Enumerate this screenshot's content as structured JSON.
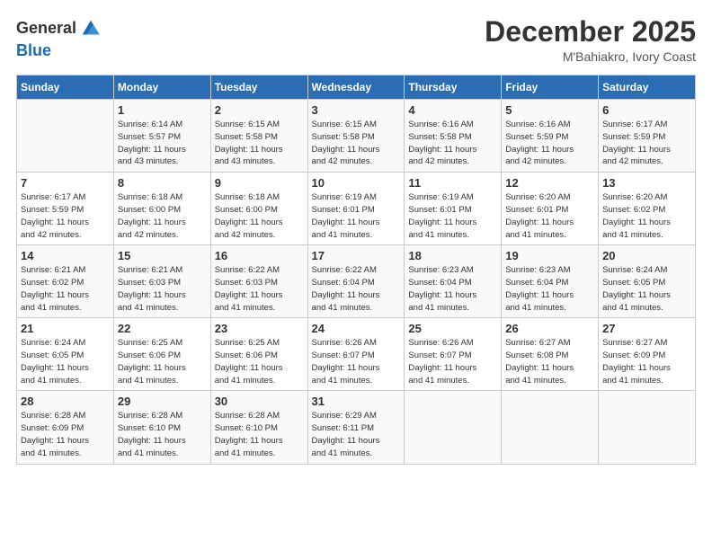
{
  "logo": {
    "general": "General",
    "blue": "Blue"
  },
  "title": "December 2025",
  "location": "M'Bahiakro, Ivory Coast",
  "days_of_week": [
    "Sunday",
    "Monday",
    "Tuesday",
    "Wednesday",
    "Thursday",
    "Friday",
    "Saturday"
  ],
  "weeks": [
    [
      {
        "day": "",
        "info": ""
      },
      {
        "day": "1",
        "info": "Sunrise: 6:14 AM\nSunset: 5:57 PM\nDaylight: 11 hours\nand 43 minutes."
      },
      {
        "day": "2",
        "info": "Sunrise: 6:15 AM\nSunset: 5:58 PM\nDaylight: 11 hours\nand 43 minutes."
      },
      {
        "day": "3",
        "info": "Sunrise: 6:15 AM\nSunset: 5:58 PM\nDaylight: 11 hours\nand 42 minutes."
      },
      {
        "day": "4",
        "info": "Sunrise: 6:16 AM\nSunset: 5:58 PM\nDaylight: 11 hours\nand 42 minutes."
      },
      {
        "day": "5",
        "info": "Sunrise: 6:16 AM\nSunset: 5:59 PM\nDaylight: 11 hours\nand 42 minutes."
      },
      {
        "day": "6",
        "info": "Sunrise: 6:17 AM\nSunset: 5:59 PM\nDaylight: 11 hours\nand 42 minutes."
      }
    ],
    [
      {
        "day": "7",
        "info": "Sunrise: 6:17 AM\nSunset: 5:59 PM\nDaylight: 11 hours\nand 42 minutes."
      },
      {
        "day": "8",
        "info": "Sunrise: 6:18 AM\nSunset: 6:00 PM\nDaylight: 11 hours\nand 42 minutes."
      },
      {
        "day": "9",
        "info": "Sunrise: 6:18 AM\nSunset: 6:00 PM\nDaylight: 11 hours\nand 42 minutes."
      },
      {
        "day": "10",
        "info": "Sunrise: 6:19 AM\nSunset: 6:01 PM\nDaylight: 11 hours\nand 41 minutes."
      },
      {
        "day": "11",
        "info": "Sunrise: 6:19 AM\nSunset: 6:01 PM\nDaylight: 11 hours\nand 41 minutes."
      },
      {
        "day": "12",
        "info": "Sunrise: 6:20 AM\nSunset: 6:01 PM\nDaylight: 11 hours\nand 41 minutes."
      },
      {
        "day": "13",
        "info": "Sunrise: 6:20 AM\nSunset: 6:02 PM\nDaylight: 11 hours\nand 41 minutes."
      }
    ],
    [
      {
        "day": "14",
        "info": "Sunrise: 6:21 AM\nSunset: 6:02 PM\nDaylight: 11 hours\nand 41 minutes."
      },
      {
        "day": "15",
        "info": "Sunrise: 6:21 AM\nSunset: 6:03 PM\nDaylight: 11 hours\nand 41 minutes."
      },
      {
        "day": "16",
        "info": "Sunrise: 6:22 AM\nSunset: 6:03 PM\nDaylight: 11 hours\nand 41 minutes."
      },
      {
        "day": "17",
        "info": "Sunrise: 6:22 AM\nSunset: 6:04 PM\nDaylight: 11 hours\nand 41 minutes."
      },
      {
        "day": "18",
        "info": "Sunrise: 6:23 AM\nSunset: 6:04 PM\nDaylight: 11 hours\nand 41 minutes."
      },
      {
        "day": "19",
        "info": "Sunrise: 6:23 AM\nSunset: 6:04 PM\nDaylight: 11 hours\nand 41 minutes."
      },
      {
        "day": "20",
        "info": "Sunrise: 6:24 AM\nSunset: 6:05 PM\nDaylight: 11 hours\nand 41 minutes."
      }
    ],
    [
      {
        "day": "21",
        "info": "Sunrise: 6:24 AM\nSunset: 6:05 PM\nDaylight: 11 hours\nand 41 minutes."
      },
      {
        "day": "22",
        "info": "Sunrise: 6:25 AM\nSunset: 6:06 PM\nDaylight: 11 hours\nand 41 minutes."
      },
      {
        "day": "23",
        "info": "Sunrise: 6:25 AM\nSunset: 6:06 PM\nDaylight: 11 hours\nand 41 minutes."
      },
      {
        "day": "24",
        "info": "Sunrise: 6:26 AM\nSunset: 6:07 PM\nDaylight: 11 hours\nand 41 minutes."
      },
      {
        "day": "25",
        "info": "Sunrise: 6:26 AM\nSunset: 6:07 PM\nDaylight: 11 hours\nand 41 minutes."
      },
      {
        "day": "26",
        "info": "Sunrise: 6:27 AM\nSunset: 6:08 PM\nDaylight: 11 hours\nand 41 minutes."
      },
      {
        "day": "27",
        "info": "Sunrise: 6:27 AM\nSunset: 6:09 PM\nDaylight: 11 hours\nand 41 minutes."
      }
    ],
    [
      {
        "day": "28",
        "info": "Sunrise: 6:28 AM\nSunset: 6:09 PM\nDaylight: 11 hours\nand 41 minutes."
      },
      {
        "day": "29",
        "info": "Sunrise: 6:28 AM\nSunset: 6:10 PM\nDaylight: 11 hours\nand 41 minutes."
      },
      {
        "day": "30",
        "info": "Sunrise: 6:28 AM\nSunset: 6:10 PM\nDaylight: 11 hours\nand 41 minutes."
      },
      {
        "day": "31",
        "info": "Sunrise: 6:29 AM\nSunset: 6:11 PM\nDaylight: 11 hours\nand 41 minutes."
      },
      {
        "day": "",
        "info": ""
      },
      {
        "day": "",
        "info": ""
      },
      {
        "day": "",
        "info": ""
      }
    ]
  ]
}
